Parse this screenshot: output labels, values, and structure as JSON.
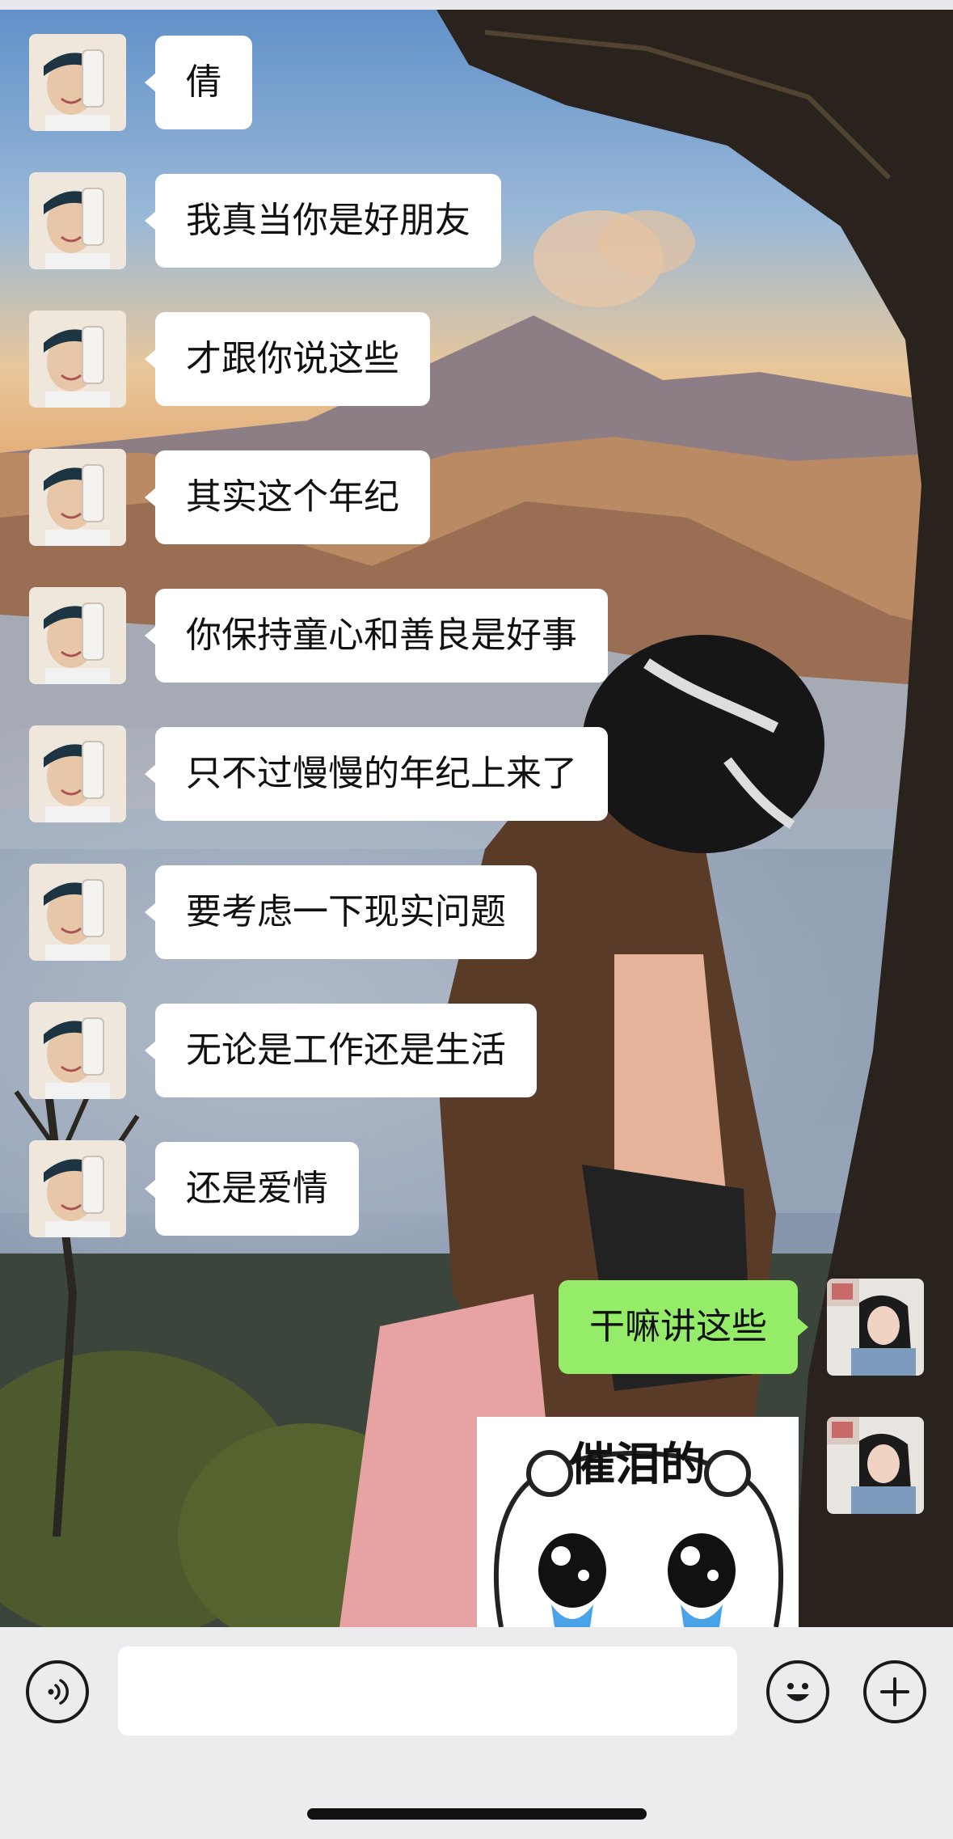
{
  "status_bar": {},
  "messages": [
    {
      "side": "left",
      "text": "倩"
    },
    {
      "side": "left",
      "text": "我真当你是好朋友"
    },
    {
      "side": "left",
      "text": "才跟你说这些"
    },
    {
      "side": "left",
      "text": "其实这个年纪"
    },
    {
      "side": "left",
      "text": "你保持童心和善良是好事"
    },
    {
      "side": "left",
      "text": "只不过慢慢的年纪上来了"
    },
    {
      "side": "left",
      "text": "要考虑一下现实问题"
    },
    {
      "side": "left",
      "text": "无论是工作还是生活"
    },
    {
      "side": "left",
      "text": "还是爱情"
    },
    {
      "side": "right",
      "text": "干嘛讲这些"
    }
  ],
  "sticker": {
    "text": "催泪的"
  },
  "input_bar": {
    "voice_icon": "voice-icon",
    "emoji_icon": "emoji-icon",
    "plus_icon": "plus-icon",
    "text_value": ""
  },
  "colors": {
    "outgoing_bubble": "#95ec69",
    "incoming_bubble": "#ffffff",
    "input_bar": "#ececef"
  }
}
